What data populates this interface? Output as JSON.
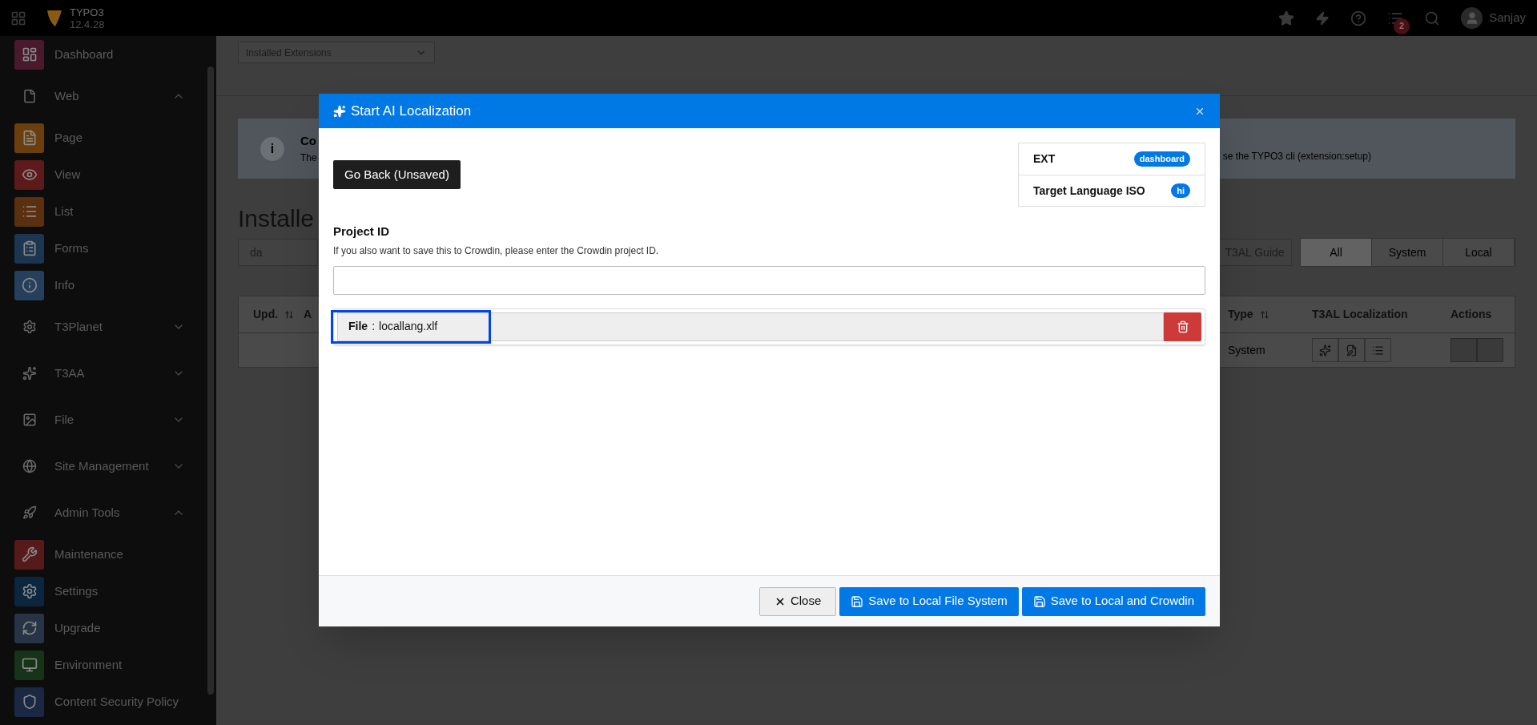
{
  "topbar": {
    "app_name": "TYPO3",
    "version": "12.4.28",
    "notification_count": "2",
    "user": "Sanjay"
  },
  "sidebar": {
    "items": [
      {
        "label": "Dashboard",
        "kind": "module",
        "color": "#4a1a2c"
      },
      {
        "label": "Web",
        "kind": "group",
        "expanded": true
      },
      {
        "label": "Page",
        "kind": "module",
        "color": "#6b3e0e"
      },
      {
        "label": "View",
        "kind": "module",
        "color": "#5e1a1a"
      },
      {
        "label": "List",
        "kind": "module",
        "color": "#5a300e"
      },
      {
        "label": "Forms",
        "kind": "module",
        "color": "#1c3550"
      },
      {
        "label": "Info",
        "kind": "module",
        "color": "#24405c"
      },
      {
        "label": "T3Planet",
        "kind": "group",
        "expanded": false
      },
      {
        "label": "T3AA",
        "kind": "group",
        "expanded": false
      },
      {
        "label": "File",
        "kind": "group",
        "expanded": false
      },
      {
        "label": "Site Management",
        "kind": "group",
        "expanded": false
      },
      {
        "label": "Admin Tools",
        "kind": "group",
        "expanded": true
      },
      {
        "label": "Maintenance",
        "kind": "module",
        "color": "#561a1a"
      },
      {
        "label": "Settings",
        "kind": "module",
        "color": "#0c2640"
      },
      {
        "label": "Upgrade",
        "kind": "module",
        "color": "#263446"
      },
      {
        "label": "Environment",
        "kind": "module",
        "color": "#183418"
      },
      {
        "label": "Content Security Policy",
        "kind": "module",
        "color": "#1a2844"
      }
    ]
  },
  "main": {
    "module_menu": {
      "value": "Installed Extensions"
    },
    "info_box": {
      "icon_glyph": "i",
      "title": "Co",
      "text": "The",
      "text_end": "se the TYPO3 cli (extension:setup)"
    },
    "heading": "Installe",
    "search": {
      "value": "da"
    },
    "guide_button": "T3AL Guide",
    "filters": [
      {
        "label": "All",
        "selected": true
      },
      {
        "label": "System",
        "selected": false
      },
      {
        "label": "Local",
        "selected": false
      }
    ],
    "table": {
      "columns_left": [
        "Upd.",
        "A"
      ],
      "columns_right": [
        "Type",
        "T3AL Localization",
        "Actions"
      ],
      "rows": [
        {
          "type": "System"
        }
      ]
    }
  },
  "modal": {
    "title": "Start AI Localization",
    "back_button": "Go Back (Unsaved)",
    "meta": [
      {
        "label": "EXT",
        "badge": "dashboard"
      },
      {
        "label": "Target Language ISO",
        "badge": "hi"
      }
    ],
    "project_id": {
      "label": "Project ID",
      "help": "If you also want to save this to Crowdin, please enter the Crowdin project ID."
    },
    "files": [
      {
        "label": "File",
        "separator": ":",
        "name": "locallang.xlf",
        "highlighted": true
      }
    ],
    "buttons": [
      {
        "label": "Close",
        "kind": "close"
      },
      {
        "label": "Save to Local File System",
        "kind": "save"
      },
      {
        "label": "Save to Local and Crowdin",
        "kind": "save"
      }
    ]
  }
}
